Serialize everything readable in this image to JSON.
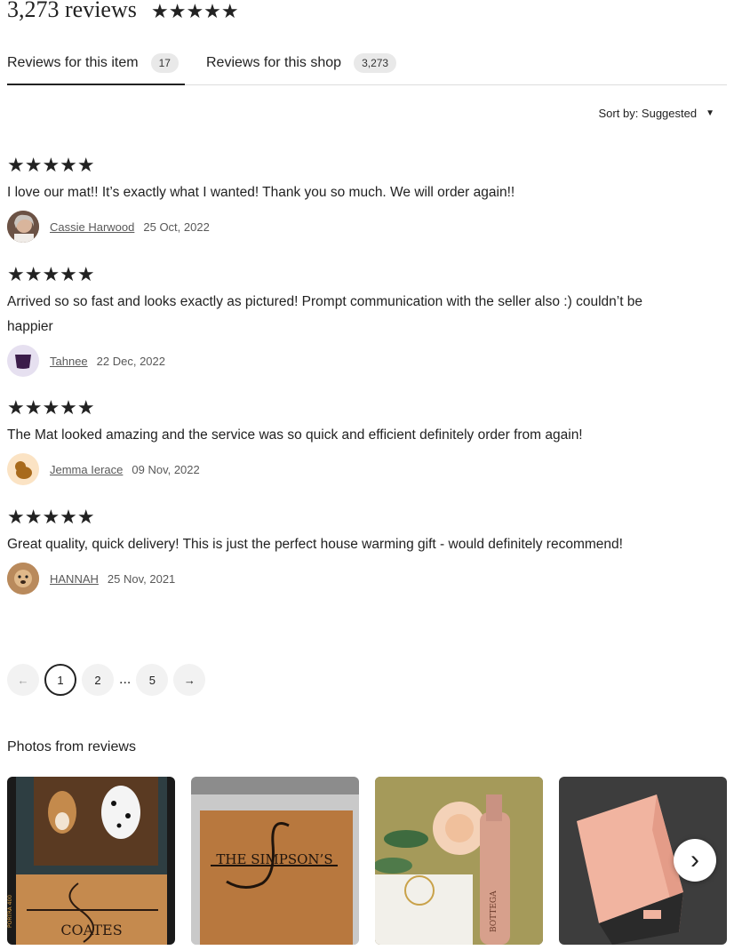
{
  "header": {
    "count_label": "3,273 reviews",
    "stars": "★★★★★"
  },
  "tabs": [
    {
      "label": "Reviews for this item",
      "count": "17"
    },
    {
      "label": "Reviews for this shop",
      "count": "3,273"
    }
  ],
  "sort": {
    "label": "Sort by: Suggested",
    "caret": "▼"
  },
  "reviews": [
    {
      "stars": "★★★★★",
      "text": "I love our mat!! It’s exactly what I wanted! Thank you so much. We will order again!!",
      "user": "Cassie Harwood",
      "date": "25 Oct, 2022"
    },
    {
      "stars": "★★★★★",
      "text": "Arrived so so fast and looks exactly as pictured! Prompt communication with the seller also :) couldn’t be happier",
      "user": "Tahnee",
      "date": "22 Dec, 2022"
    },
    {
      "stars": "★★★★★",
      "text": "The Mat looked amazing and the service was so quick and efficient definitely order from again!",
      "user": "Jemma Ierace",
      "date": "09 Nov, 2022"
    },
    {
      "stars": "★★★★★",
      "text": "Great quality, quick delivery! This is just the perfect house warming gift - would definitely recommend!",
      "user": "HANNAH",
      "date": "25 Nov, 2021"
    }
  ],
  "pagination": {
    "prev": "←",
    "pages": [
      "1",
      "2"
    ],
    "ellipsis": "...",
    "last": "5",
    "next": "→",
    "current": "1"
  },
  "photos": {
    "title": "Photos from reviews",
    "items": [
      {
        "mat_text": "COATES",
        "film_text": "PORTRA 400"
      },
      {
        "mat_text": "THE SIMPSON’S"
      },
      {
        "bottle_text": "BOTTEGA"
      },
      {}
    ],
    "next": "›"
  }
}
